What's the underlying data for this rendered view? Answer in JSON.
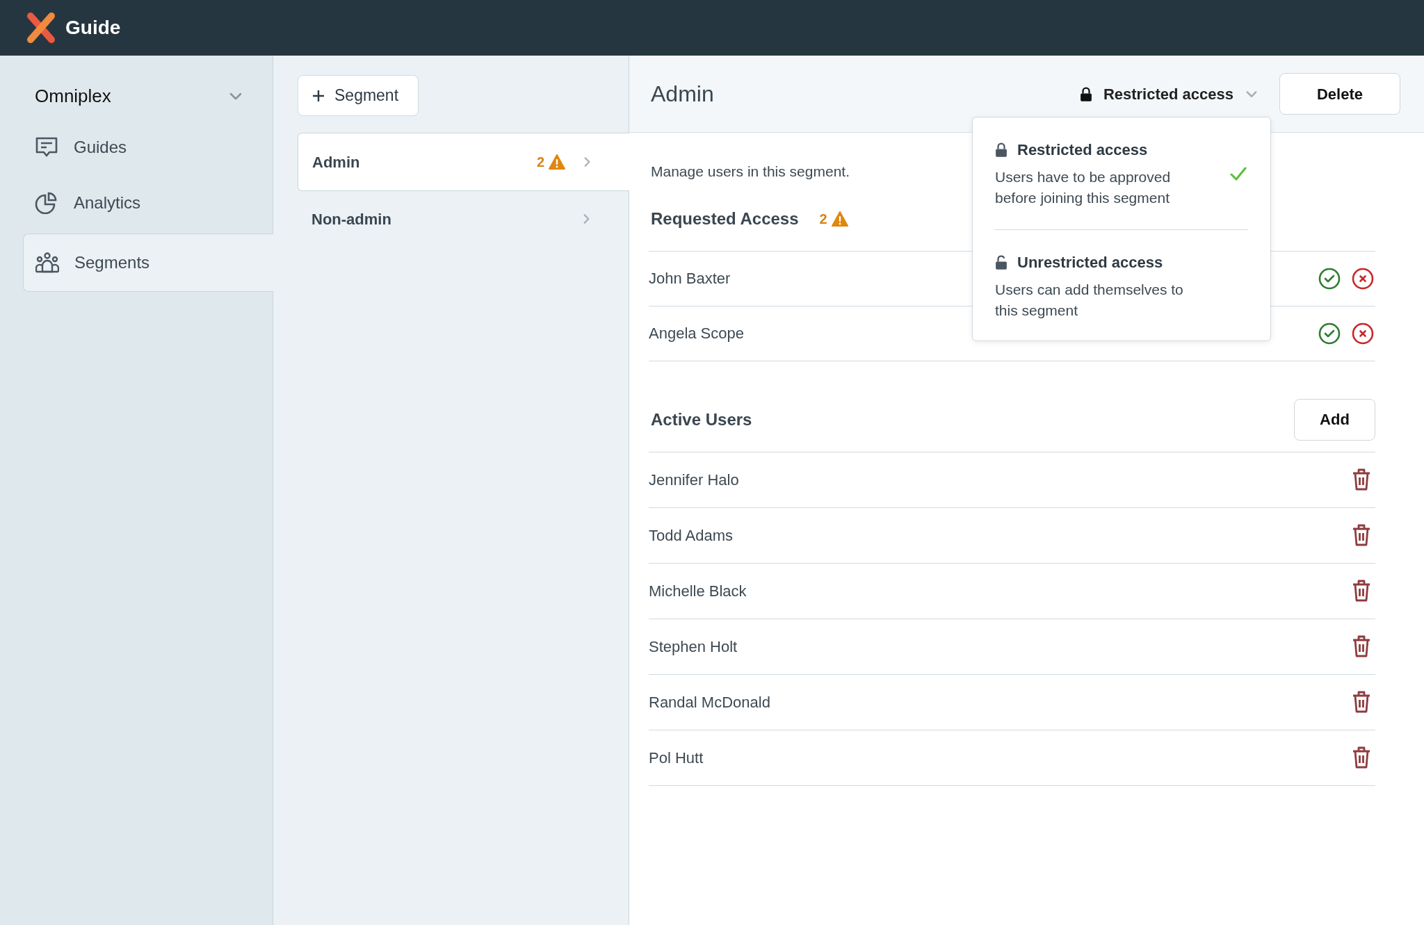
{
  "app": {
    "title": "Guide"
  },
  "sidebar": {
    "workspace": "Omniplex",
    "items": [
      {
        "label": "Guides",
        "kind": "guides",
        "selected": false
      },
      {
        "label": "Analytics",
        "kind": "analytics",
        "selected": false
      },
      {
        "label": "Segments",
        "kind": "segments",
        "selected": true
      }
    ]
  },
  "segments": {
    "add_button": "Segment",
    "items": [
      {
        "name": "Admin",
        "count": "2",
        "warning": true,
        "selected": true
      },
      {
        "name": "Non-admin",
        "warning": false,
        "selected": false
      }
    ]
  },
  "detail": {
    "title": "Admin",
    "access_dropdown": {
      "label": "Restricted access",
      "expanded": true
    },
    "delete_button": "Delete",
    "description": "Manage users in this segment.",
    "requested": {
      "title": "Requested Access",
      "count": "2",
      "users": [
        "John Baxter",
        "Angela Scope"
      ]
    },
    "active": {
      "title": "Active Users",
      "add_button": "Add",
      "users": [
        "Jennifer Halo",
        "Todd Adams",
        "Michelle Black",
        "Stephen Holt",
        "Randal McDonald",
        "Pol Hutt"
      ]
    }
  },
  "access_menu": [
    {
      "title": "Restricted access",
      "description": "Users have to be approved before joining this segment",
      "locked": true,
      "selected": true
    },
    {
      "title": "Unrestricted access",
      "description": "Users can add themselves to this segment",
      "locked": false,
      "selected": false
    }
  ]
}
